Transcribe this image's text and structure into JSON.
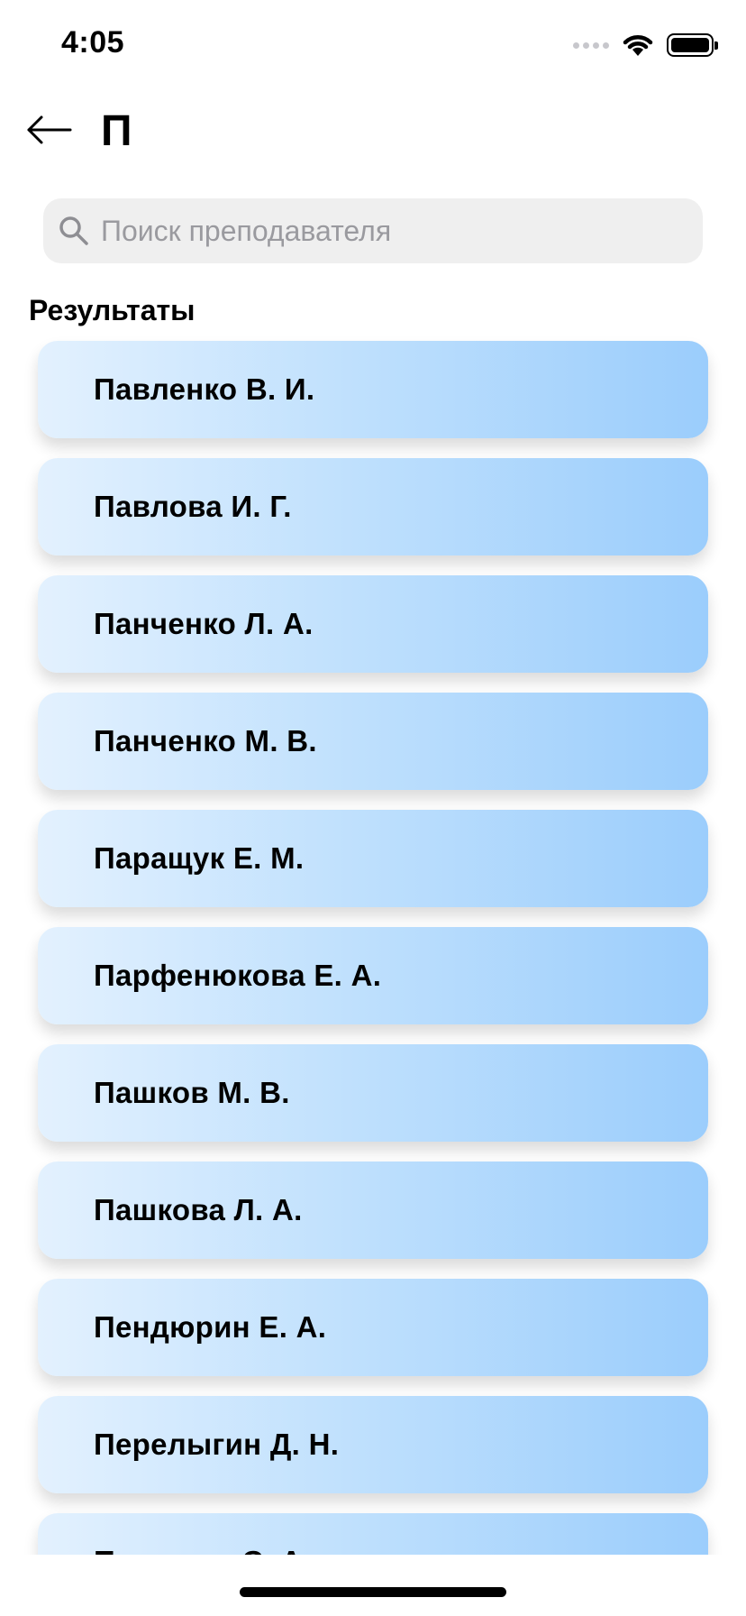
{
  "status_bar": {
    "time": "4:05"
  },
  "nav": {
    "title": "П",
    "back_icon": "arrow-left-icon"
  },
  "search": {
    "placeholder": "Поиск преподавателя",
    "value": "",
    "icon": "search-icon"
  },
  "results": {
    "title": "Результаты",
    "items": [
      "Павленко В. И.",
      "Павлова И. Г.",
      "Панченко Л. А.",
      "Панченко М. В.",
      "Паращук Е. М.",
      "Парфенюкова Е. А.",
      "Пашков М. В.",
      "Пашкова Л. А.",
      "Пендюрин Е. А.",
      "Перелыгин Д. Н.",
      "Петренко С. А."
    ]
  },
  "colors": {
    "card_gradient_start": "#e3f1fe",
    "card_gradient_end": "#9bcdfc",
    "search_bg": "#efefef",
    "placeholder": "#9a9a9f"
  }
}
